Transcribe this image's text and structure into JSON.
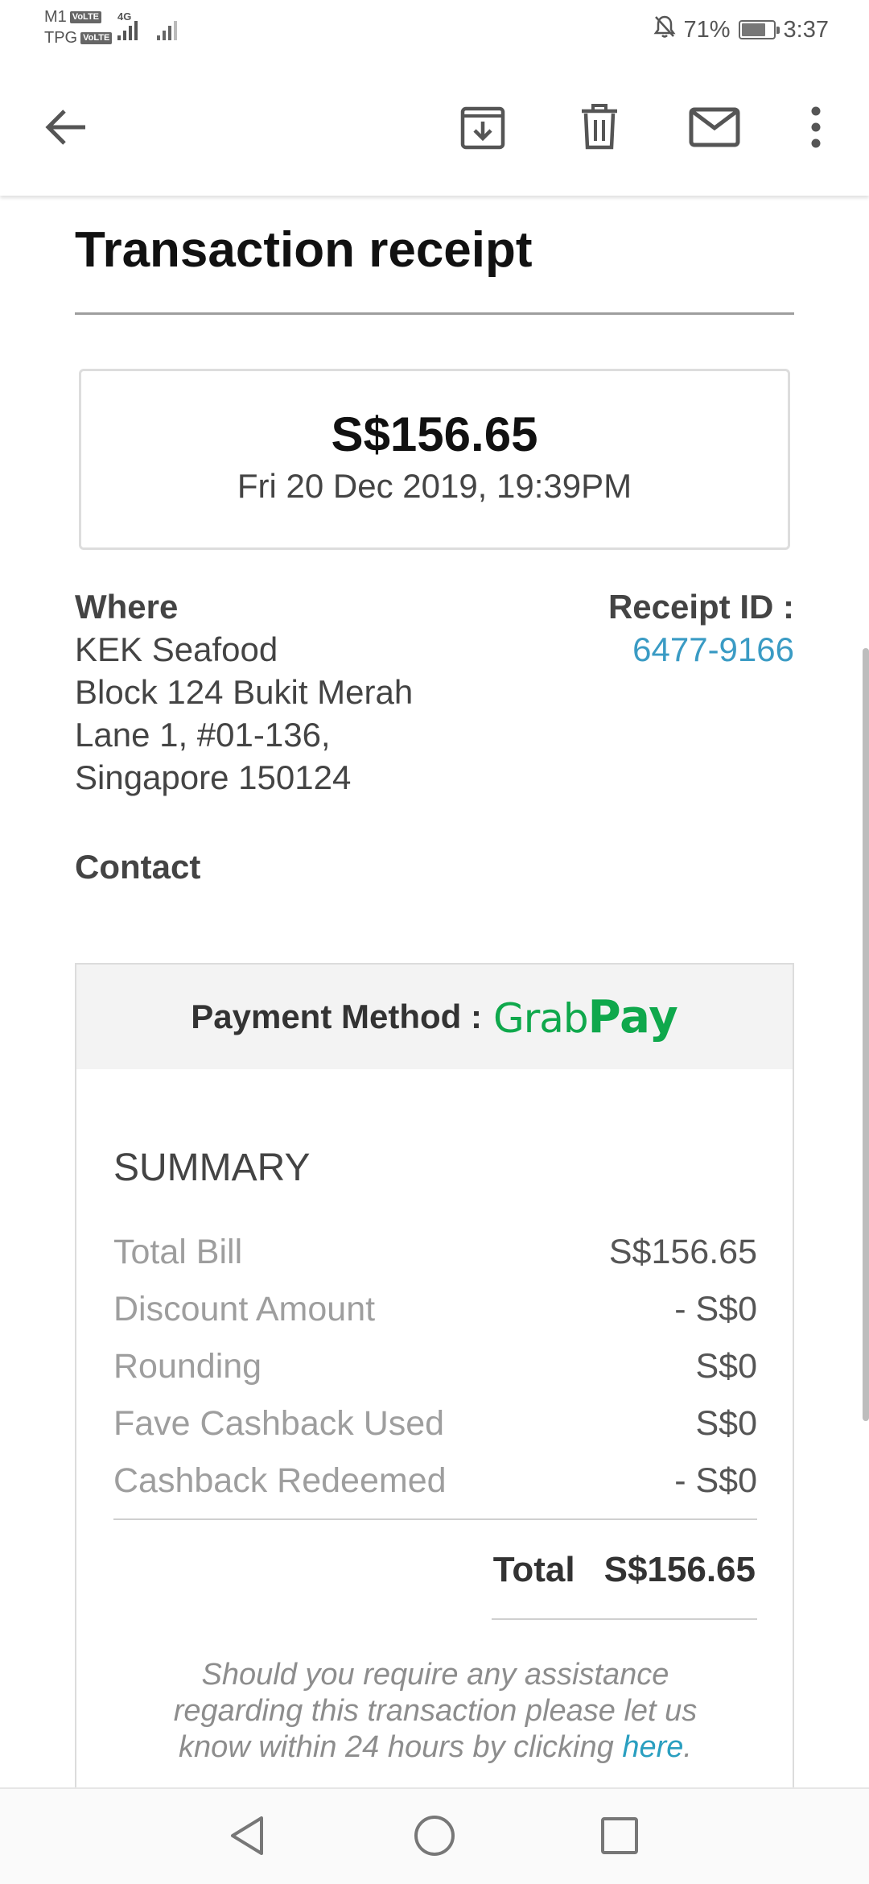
{
  "status_bar": {
    "carrier1": "M1",
    "carrier2": "TPG",
    "volte": "VoLTE",
    "network": "4G",
    "battery_percent": "71%",
    "time": "3:37",
    "battery_level": 0.71
  },
  "toolbar": {
    "icons": [
      "back-arrow-icon",
      "archive-icon",
      "delete-icon",
      "mail-icon",
      "more-vert-icon"
    ]
  },
  "receipt": {
    "title": "Transaction receipt",
    "amount": "S$156.65",
    "datetime": "Fri 20 Dec 2019, 19:39PM",
    "where_label": "Where",
    "address": [
      "KEK Seafood",
      "Block 124 Bukit Merah",
      "Lane 1, #01-136,",
      "Singapore 150124"
    ],
    "receipt_id_label": "Receipt ID :",
    "receipt_id": "6477-9166",
    "contact_label": "Contact"
  },
  "payment": {
    "label": "Payment Method :",
    "grab": "Grab",
    "pay": "Pay",
    "brand_color": "#0fa84c"
  },
  "summary": {
    "title": "SUMMARY",
    "rows": [
      {
        "label": "Total Bill",
        "value": "S$156.65"
      },
      {
        "label": "Discount Amount",
        "value": "- S$0"
      },
      {
        "label": "Rounding",
        "value": "S$0"
      },
      {
        "label": "Fave Cashback Used",
        "value": "S$0"
      },
      {
        "label": "Cashback Redeemed",
        "value": "- S$0"
      }
    ],
    "total_label": "Total",
    "total_value": "S$156.65",
    "assist_lines": [
      "Should you require any assistance",
      "regarding this transaction please let us"
    ],
    "assist_line3": "know within 24 hours by clicking ",
    "assist_link": "here",
    "assist_end": "."
  },
  "colors": {
    "link": "#3a9bc4",
    "divider": "#9e9e9e"
  }
}
